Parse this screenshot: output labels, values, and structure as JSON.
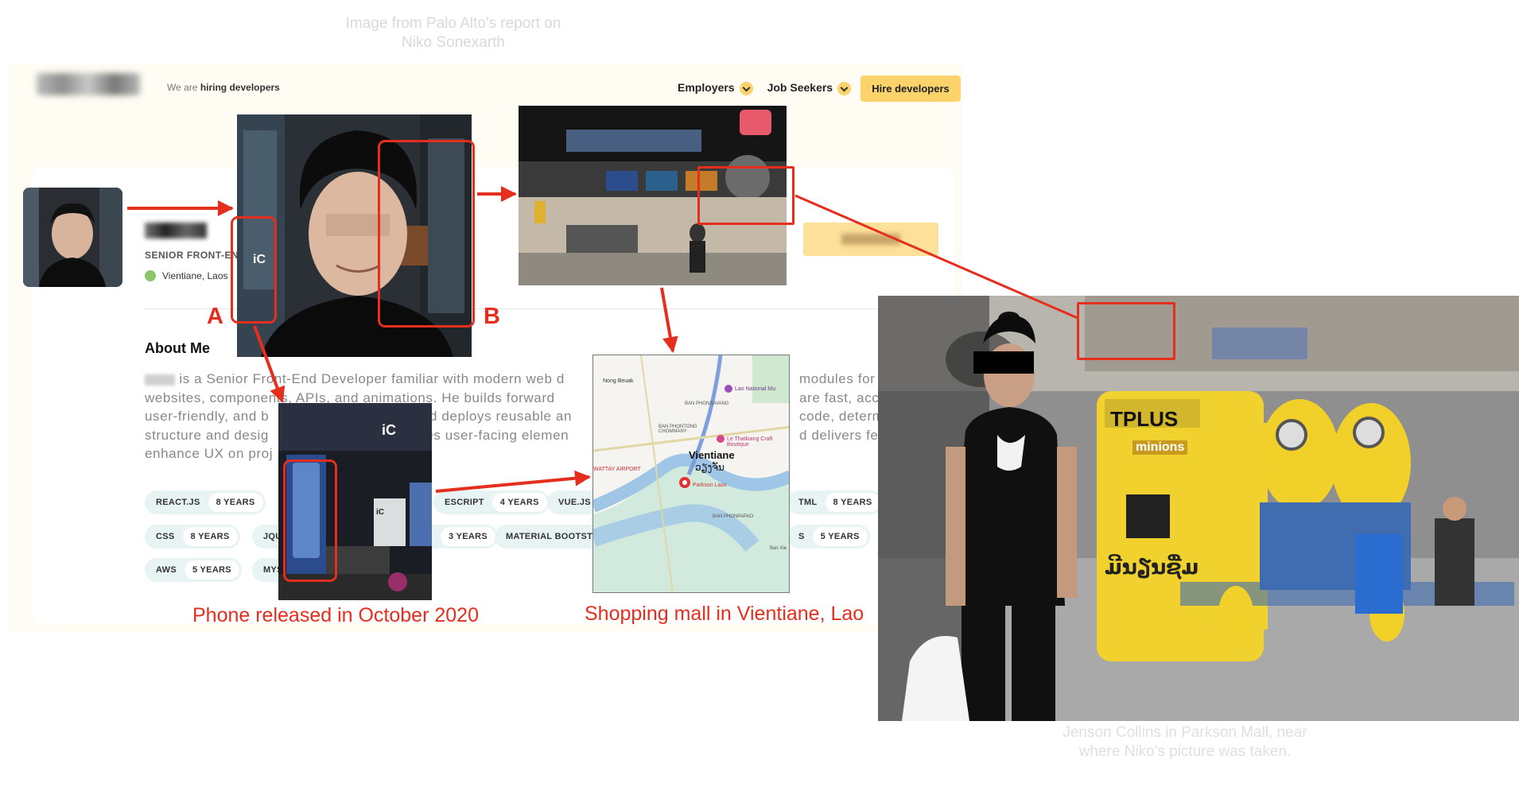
{
  "captions": {
    "top": "Image from Palo Alto's report on Niko Sonexarth",
    "bottom": "Jenson Collins in Parkson Mall, near where Niko's picture was taken."
  },
  "site": {
    "tagline_prefix": "We are",
    "tagline_bold": "hiring developers",
    "nav": [
      "Employers",
      "Job Seekers"
    ],
    "hire_button": "Hire developers",
    "profile_title": "SENIOR FRONT-END",
    "location": "Vientiane, Laos",
    "about_heading": "About Me",
    "about_lines": [
      "is a Senior Front-End Developer familiar with modern web d",
      "websites, components, APIs, and animations. He builds forward",
      "user-friendly, and b",
      "structure and desig",
      "enhance UX on proj"
    ],
    "about_right": [
      "modules for",
      "are fast, acc",
      "code, determ",
      "d delivers fea"
    ],
    "about_mid": [
      "nd deploys reusable an",
      "tes user-facing elemen"
    ],
    "skills": [
      {
        "name": "REACT.JS",
        "years": "8 YEARS"
      },
      {
        "name": "ESCRIPT",
        "years": "4 YEARS"
      },
      {
        "name": "VUE.JS",
        "years": ""
      },
      {
        "name": "TML",
        "years": "8 YEARS"
      },
      {
        "name": "CSS",
        "years": "8 YEARS"
      },
      {
        "name": "JQUE",
        "years": ""
      },
      {
        "name": "",
        "years": "3 YEARS"
      },
      {
        "name": "MATERIAL BOOTSTR",
        "years": ""
      },
      {
        "name": "S",
        "years": "5 YEARS"
      },
      {
        "name": "AWS",
        "years": "5 YEARS"
      },
      {
        "name": "MYS",
        "years": ""
      }
    ]
  },
  "annotations": {
    "label_a": "A",
    "label_b": "B",
    "phone_caption": "Phone released in October 2020",
    "mall_caption": "Shopping mall in Vientiane, Lao"
  },
  "map": {
    "labels": [
      "Nong Beuak",
      "Vientiane",
      "ວຽງຈັນ",
      "Parkson Laos",
      "Lao National Mu",
      "Le Thatkiang Craft Boutique",
      "BAN PHONTONG CHOMMANY",
      "BAN PHONSAVANG",
      "WATTAY AIRPORT",
      "BAN PHONPAPAO",
      "Ban Xie"
    ]
  },
  "mall_photo": {
    "sign_tplus": "TPLUS",
    "sign_minions": "minions",
    "sign_lao": "ມີນຽນຊື່ມ"
  },
  "colors": {
    "annotation_red": "#e52e1e",
    "accent_yellow": "#fbd36a"
  }
}
